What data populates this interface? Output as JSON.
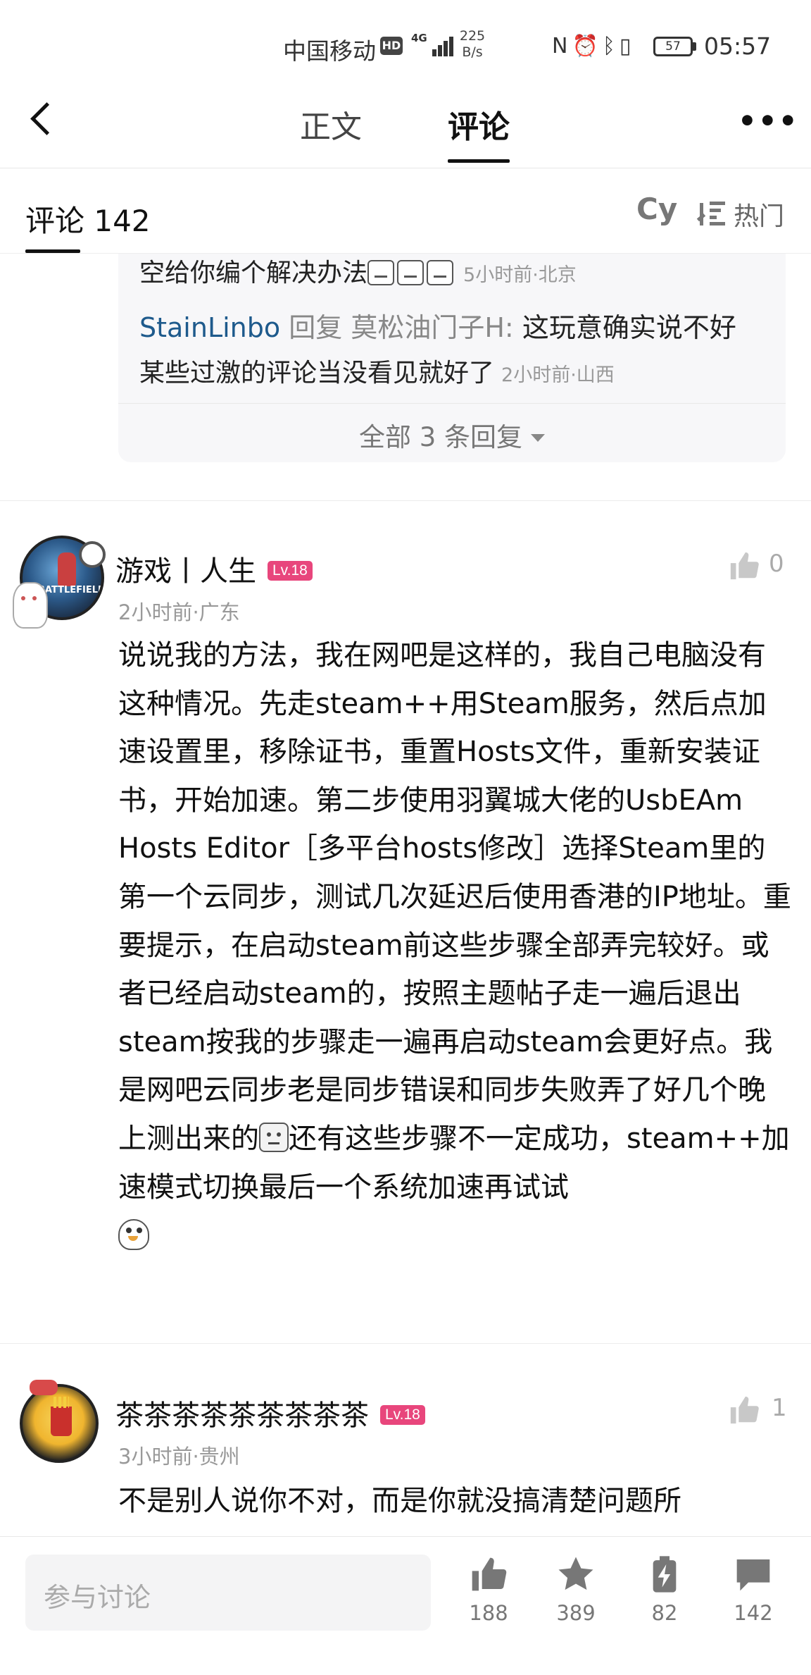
{
  "status_bar": {
    "carrier": "中国移动",
    "hd": "HD",
    "network": "4G",
    "speed_value": "225",
    "speed_unit": "B/s",
    "battery": "57",
    "time": "05:57"
  },
  "nav": {
    "tab_body": "正文",
    "tab_comments": "评论",
    "more": "•••"
  },
  "comments_header": {
    "label": "评论 142",
    "cy": "Cy",
    "sort": "热门"
  },
  "reply_thread": {
    "line1_text": "空给你编个解决办法",
    "line1_meta": "5小时前·北京",
    "reply_user": "StainLinbo",
    "reply_word": "回复",
    "reply_target": "莫松油门子H:",
    "reply_text": "这玩意确实说不好",
    "reply_text2": "某些过激的评论当没看见就好了",
    "reply_meta": "2小时前·山西",
    "all_replies": "全部 3 条回复"
  },
  "comment1": {
    "username": "游戏丨人生",
    "level": "Lv.18",
    "meta": "2小时前·广东",
    "likes": "0",
    "text_part1": "说说我的方法，我在网吧是这样的，我自己电脑没有这种情况。先走steam++用Steam服务，然后点加速设置里，移除证书，重置Hosts文件，重新安装证书，开始加速。第二步使用羽翼城大佬的UsbEAm Hosts Editor［多平台hosts修改］选择Steam里的第一个云同步，测试几次延迟后使用香港的IP地址。重要提示，在启动steam前这些步骤全部弄完较好。或者已经启动steam的，按照主题帖子走一遍后退出steam按我的步骤走一遍再启动steam会更好点。我是网吧云同步老是同步错误和同步失败弄了好几个晚上测出来的",
    "text_part2": "还有这些步骤不一定成功，steam++加速模式切换最后一个系统加速再试试"
  },
  "comment2": {
    "username": "茶茶茶茶茶茶茶茶茶",
    "level": "Lv.18",
    "meta": "3小时前·贵州",
    "likes": "1",
    "text": "不是别人说你不对，而是你就没搞清楚问题所"
  },
  "bottom_bar": {
    "input_placeholder": "参与讨论",
    "likes": "188",
    "favorites": "389",
    "shares": "82",
    "comments": "142"
  }
}
